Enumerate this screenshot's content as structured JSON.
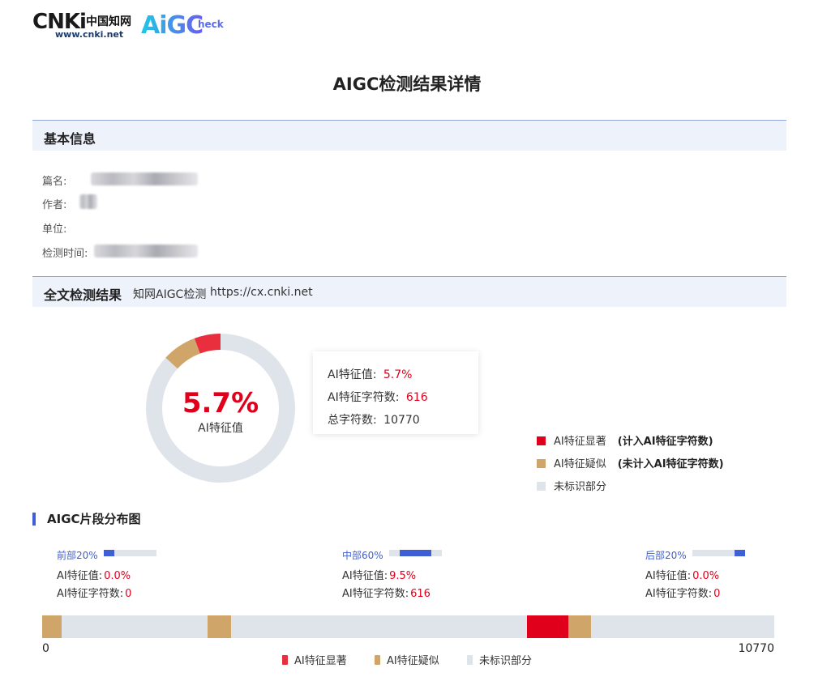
{
  "header": {
    "cnki_mark": "CNKi",
    "cnki_cn": "中国知网",
    "cnki_url": "www.cnki.net",
    "aigc_logo": "AiGC",
    "aigc_logo_suffix": "heck"
  },
  "title": "AIGC检测结果详情",
  "basic_info": {
    "section_title": "基本信息",
    "fields": [
      {
        "label": "篇名:"
      },
      {
        "label": "作者:"
      },
      {
        "label": "单位:"
      },
      {
        "label": "检测时间:"
      }
    ]
  },
  "full_result": {
    "section_title": "全文检测结果",
    "source_label": "知网AIGC检测",
    "source_url": "https://cx.cnki.net",
    "donut_value": "5.7%",
    "donut_label": "AI特征值",
    "stats": {
      "ai_value_label": "AI特征值:",
      "ai_value": "5.7%",
      "ai_chars_label": "AI特征字符数:",
      "ai_chars": "616",
      "total_chars_label": "总字符数:",
      "total_chars": "10770"
    },
    "legend": [
      {
        "label": "AI特征显著",
        "note": "(计入AI特征字符数)",
        "color": "#e0001b"
      },
      {
        "label": "AI特征疑似",
        "note": "(未计入AI特征字符数)",
        "color": "#cfa56a"
      },
      {
        "label": "未标识部分",
        "note": "",
        "color": "#dfe3ea"
      }
    ]
  },
  "chart_data": [
    {
      "type": "pie",
      "categories": [
        "AI特征显著",
        "AI特征疑似",
        "未标识部分"
      ],
      "values": [
        5.7,
        7.5,
        86.8
      ],
      "colors": [
        "#e92e3d",
        "#cfa56a",
        "#dfe3ea"
      ],
      "center_value": "5.7%",
      "center_label": "AI特征值"
    }
  ],
  "distribution": {
    "title": "AIGC片段分布图",
    "parts": [
      {
        "name": "前部20%",
        "ai_value_label": "AI特征值:",
        "ai_value": "0.0%",
        "ai_chars_label": "AI特征字符数:",
        "ai_chars": "0",
        "bar_start": 0.0,
        "bar_end": 0.2
      },
      {
        "name": "中部60%",
        "ai_value_label": "AI特征值:",
        "ai_value": "9.5%",
        "ai_chars_label": "AI特征字符数:",
        "ai_chars": "616",
        "bar_start": 0.2,
        "bar_end": 0.8
      },
      {
        "name": "后部20%",
        "ai_value_label": "AI特征值:",
        "ai_value": "0.0%",
        "ai_chars_label": "AI特征字符数:",
        "ai_chars": "0",
        "bar_start": 0.8,
        "bar_end": 1.0
      }
    ],
    "total": 10770,
    "axis_start": "0",
    "axis_end": "10770",
    "segments": [
      {
        "type": "suspect",
        "start": 0,
        "end": 290,
        "color": "#cfa56a"
      },
      {
        "type": "suspect",
        "start": 2435,
        "end": 2780,
        "color": "#cfa56a"
      },
      {
        "type": "significant",
        "start": 7130,
        "end": 7746,
        "color": "#e0001b"
      },
      {
        "type": "suspect",
        "start": 7746,
        "end": 8080,
        "color": "#cfa56a"
      }
    ],
    "legend": [
      {
        "label": "AI特征显著",
        "color": "#e92e3d"
      },
      {
        "label": "AI特征疑似",
        "color": "#cfa56a"
      },
      {
        "label": "未标识部分",
        "color": "#dfe3ea"
      }
    ]
  }
}
